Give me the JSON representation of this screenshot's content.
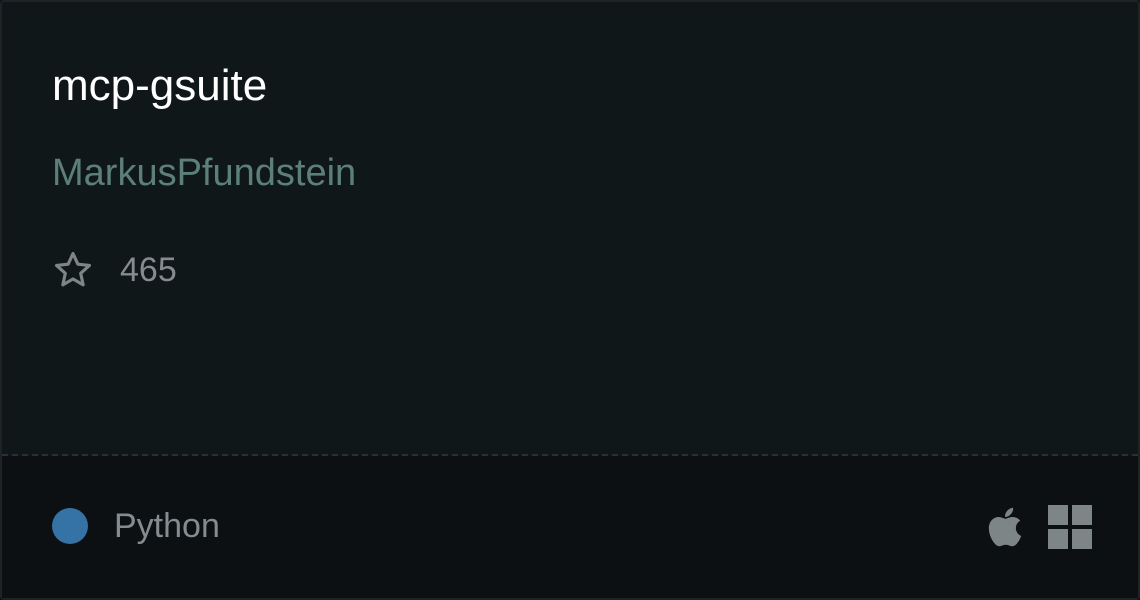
{
  "repo": {
    "name": "mcp-gsuite",
    "owner": "MarkusPfundstein",
    "stars": "465",
    "language": "Python",
    "language_color": "#3572a5"
  },
  "icons": {
    "star": "star-outline-icon",
    "platforms": [
      "apple-icon",
      "windows-icon"
    ]
  },
  "colors": {
    "background": "#101719",
    "footer_background": "#0c1012",
    "title": "#ffffff",
    "owner": "#5c7f7a",
    "muted": "#858b8e",
    "icon": "#7e8587"
  }
}
